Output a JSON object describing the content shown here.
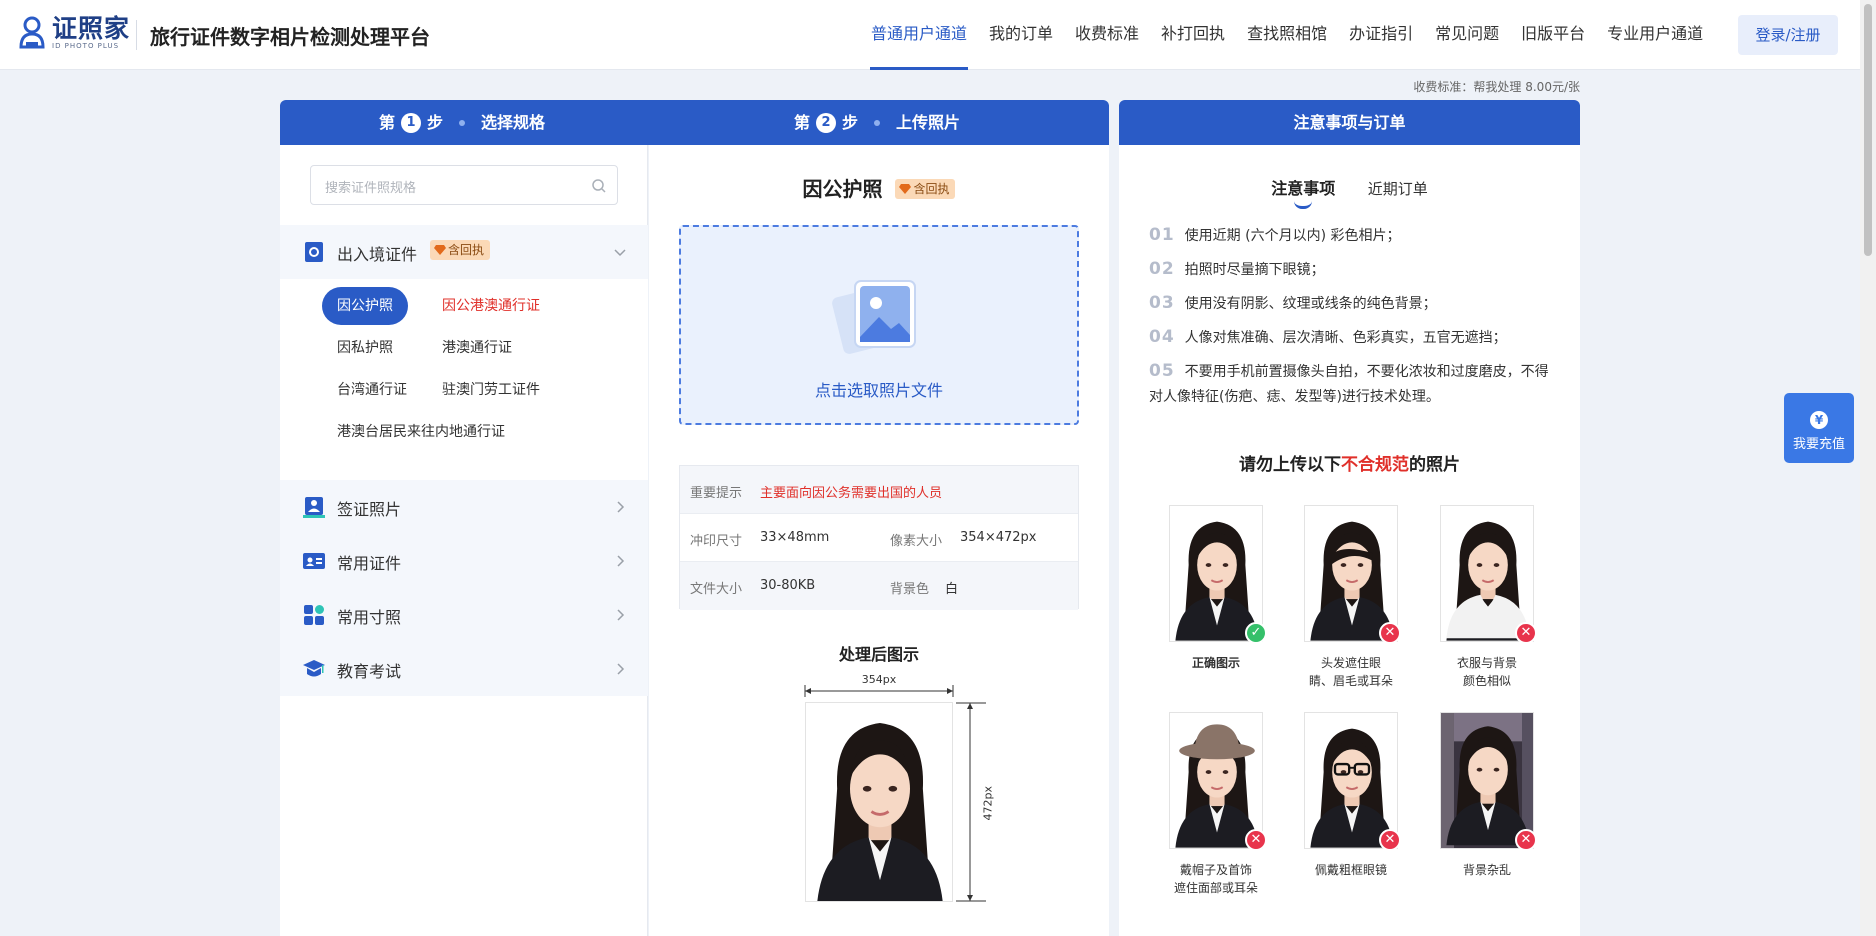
{
  "header": {
    "logo_main": "证照家",
    "logo_sub": "ID PHOTO PLUS",
    "site_title": "旅行证件数字相片检测处理平台",
    "nav": [
      "普通用户通道",
      "我的订单",
      "收费标准",
      "补打回执",
      "查找照相馆",
      "办证指引",
      "常见问题",
      "旧版平台",
      "专业用户通道"
    ],
    "login": "登录/注册"
  },
  "fee_note": "收费标准：帮我处理 8.00元/张",
  "steps": {
    "step1_prefix": "第",
    "step1_num": "1",
    "step1_suffix": "步",
    "step1_label": "选择规格",
    "step2_prefix": "第",
    "step2_num": "2",
    "step2_suffix": "步",
    "step2_label": "上传照片",
    "right_title": "注意事项与订单"
  },
  "left": {
    "search_placeholder": "搜索证件照规格",
    "open_category": "出入境证件",
    "badge": "含回执",
    "sub_items": [
      "因公护照",
      "因公港澳通行证",
      "因私护照",
      "港澳通行证",
      "台湾通行证",
      "驻澳门劳工证件",
      "港澳台居民来往内地通行证"
    ],
    "categories": [
      "签证照片",
      "常用证件",
      "常用寸照",
      "教育考试"
    ]
  },
  "mid": {
    "title": "因公护照",
    "badge": "含回执",
    "upload_text": "点击选取照片文件",
    "info": {
      "tip_key": "重要提示",
      "tip_val": "主要面向因公务需要出国的人员",
      "print_key": "冲印尺寸",
      "print_val": "33×48mm",
      "pixel_key": "像素大小",
      "pixel_val": "354×472px",
      "file_key": "文件大小",
      "file_val": "30-80KB",
      "bg_key": "背景色",
      "bg_val": "白"
    },
    "after_title": "处理后图示",
    "width_label": "354px",
    "height_label": "472px"
  },
  "right": {
    "tabs": [
      "注意事项",
      "近期订单"
    ],
    "notes": [
      {
        "num": "01",
        "text": "使用近期 (六个月以内) 彩色相片；"
      },
      {
        "num": "02",
        "text": "拍照时尽量摘下眼镜；"
      },
      {
        "num": "03",
        "text": "使用没有阴影、纹理或线条的纯色背景；"
      },
      {
        "num": "04",
        "text": "人像对焦准确、层次清晰、色彩真实，五官无遮挡；"
      },
      {
        "num": "05",
        "text": "不要用手机前置摄像头自拍，不要化浓妆和过度磨皮，不得对人像特征(伤疤、痣、发型等)进行技术处理。"
      }
    ],
    "warn_prefix": "请勿上传以下",
    "warn_red": "不合规范",
    "warn_suffix": "的照片",
    "samples": [
      {
        "line1": "正确图示",
        "line2": "",
        "ok": true
      },
      {
        "line1": "头发遮住眼",
        "line2": "睛、眉毛或耳朵",
        "ok": false
      },
      {
        "line1": "衣服与背景",
        "line2": "颜色相似",
        "ok": false
      },
      {
        "line1": "戴帽子及首饰",
        "line2": "遮住面部或耳朵",
        "ok": false
      },
      {
        "line1": "佩戴粗框眼镜",
        "line2": "",
        "ok": false
      },
      {
        "line1": "背景杂乱",
        "line2": "",
        "ok": false
      }
    ],
    "ok_mark": "✓",
    "bad_mark": "✕"
  },
  "fab": {
    "icon": "¥",
    "label": "我要充值"
  },
  "colors": {
    "primary": "#2a5bc6",
    "red": "#e0302a",
    "badge_bg": "#fbd9b7"
  }
}
